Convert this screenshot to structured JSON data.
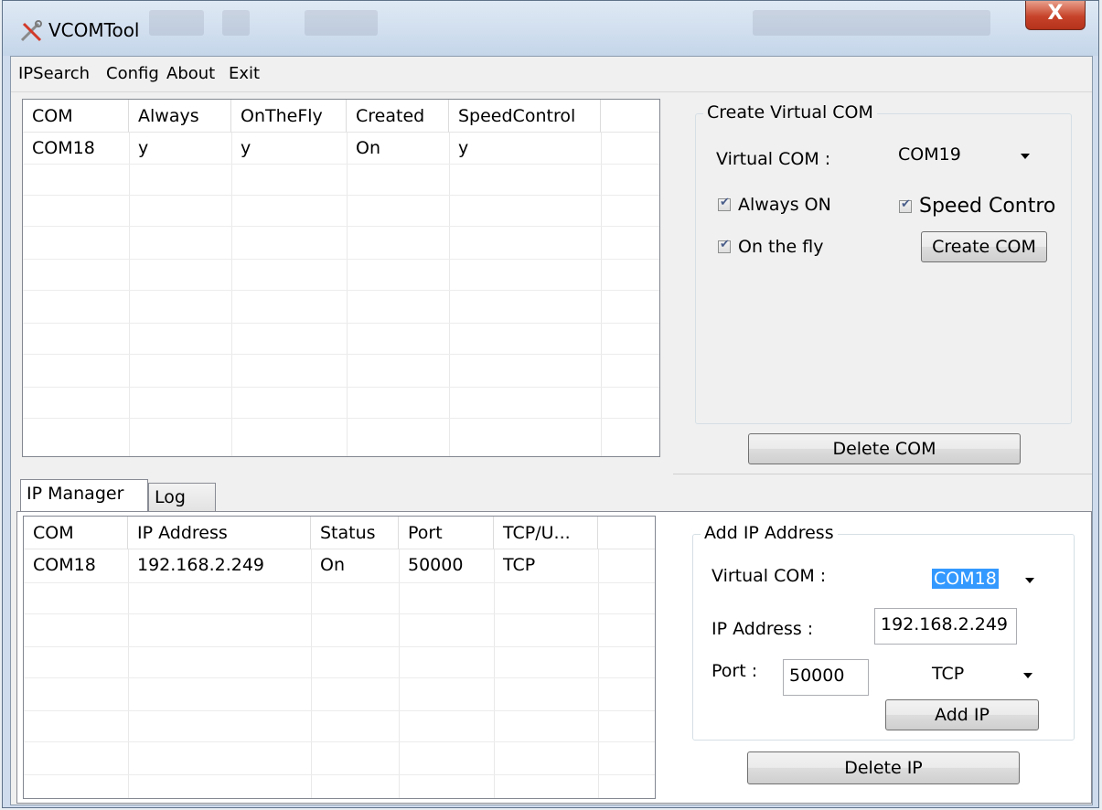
{
  "window": {
    "title": "VCOMTool",
    "close_glyph": "X"
  },
  "menu": [
    "IPSearch",
    "Config",
    "About",
    "Exit"
  ],
  "com_table": {
    "columns": [
      "COM",
      "Always",
      "OnTheFly",
      "Created",
      "SpeedControl"
    ],
    "rows": [
      [
        "COM18",
        "y",
        "y",
        "On",
        "y"
      ]
    ]
  },
  "create_com": {
    "group_title": "Create Virtual COM",
    "virtual_com_label": "Virtual COM :",
    "virtual_com_value": "COM19",
    "always_on_label": "Always ON",
    "always_on_checked": true,
    "speed_control_label": "Speed Contro",
    "speed_control_checked": true,
    "on_the_fly_label": "On the fly",
    "on_the_fly_checked": true,
    "create_button": "Create COM",
    "delete_button": "Delete COM"
  },
  "tabs": {
    "ip_manager": "IP Manager",
    "log": "Log"
  },
  "ip_table": {
    "columns": [
      "COM",
      "IP Address",
      "Status",
      "Port",
      "TCP/U..."
    ],
    "rows": [
      [
        "COM18",
        "192.168.2.249",
        "On",
        "50000",
        "TCP"
      ]
    ]
  },
  "add_ip": {
    "group_title": "Add IP Address",
    "virtual_com_label": "Virtual COM :",
    "virtual_com_value": "COM18",
    "ip_label": "IP Address :",
    "ip_value": "192.168.2.249",
    "port_label": "Port :",
    "port_value": "50000",
    "protocol_value": "TCP",
    "add_button": "Add IP",
    "delete_button": "Delete IP"
  },
  "colors": {
    "selection": "#3399ff",
    "close_button": "#c7432a",
    "titlebar": "#cfdced"
  },
  "icons": {
    "app": "tools-icon",
    "close": "close-icon",
    "dropdown": "chevron-down-icon",
    "check": "checkmark-icon"
  }
}
